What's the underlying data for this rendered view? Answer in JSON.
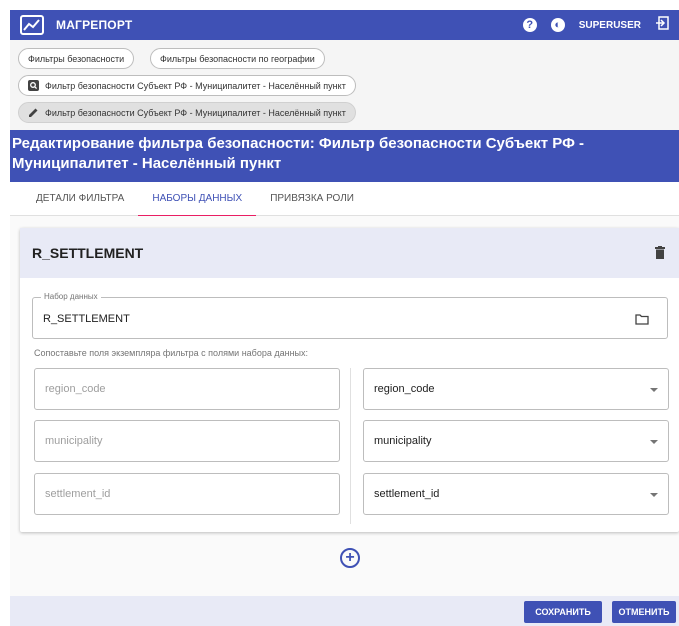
{
  "app": {
    "title": "МАГРЕПОРТ",
    "user": "SUPERUSER",
    "help_glyph": "?",
    "theme_glyph": "◐"
  },
  "chips": [
    {
      "label": "Фильтры безопасности",
      "icon": ""
    },
    {
      "label": "Фильтры безопасности по географии",
      "icon": ""
    },
    {
      "label": "Фильтр безопасности Субъект РФ - Муниципалитет - Населённый пункт",
      "icon": "search-icon"
    },
    {
      "label": "Фильтр безопасности Субъект РФ - Муниципалитет - Населённый пункт",
      "icon": "pencil-icon"
    }
  ],
  "page": {
    "title": "Редактирование фильтра безопасности: Фильтр безопасности Субъект РФ - Муниципалитет - Населённый пункт"
  },
  "tabs": [
    {
      "label": "ДЕТАЛИ ФИЛЬТРА",
      "active": false
    },
    {
      "label": "НАБОРЫ ДАННЫХ",
      "active": true
    },
    {
      "label": "ПРИВЯЗКА РОЛИ",
      "active": false
    }
  ],
  "dataset_card": {
    "title": "R_SETTLEMENT",
    "dataset_field": {
      "label": "Набор данных",
      "value": "R_SETTLEMENT"
    },
    "hint": "Сопоставьте поля экземпляра фильтра с полями набора данных:",
    "mappings": [
      {
        "filter_field": "region_code",
        "dataset_field": "region_code"
      },
      {
        "filter_field": "municipality",
        "dataset_field": "municipality"
      },
      {
        "filter_field": "settlement_id",
        "dataset_field": "settlement_id"
      }
    ]
  },
  "add_glyph": "+",
  "footer": {
    "save_label": "СОХРАНИТЬ",
    "cancel_label": "ОТМЕНИТЬ"
  },
  "colors": {
    "primary": "#3f51b5",
    "accent": "#e91e63",
    "card_header": "#e8eaf6"
  }
}
